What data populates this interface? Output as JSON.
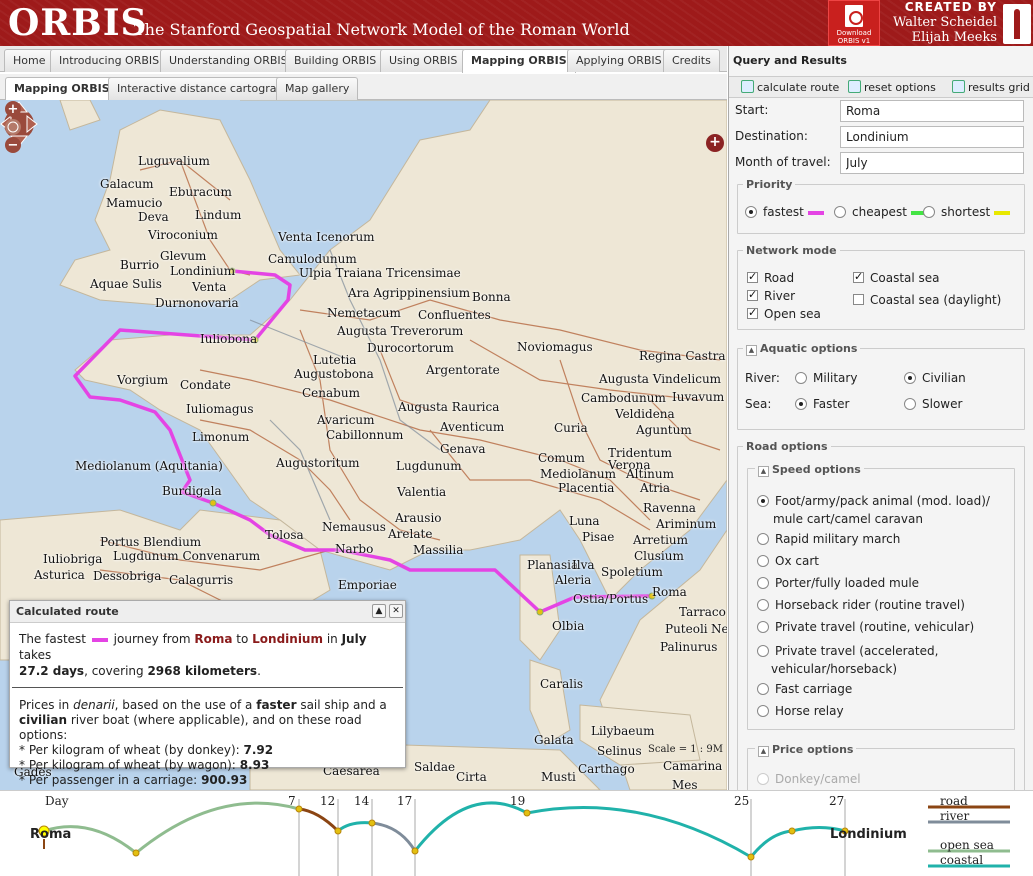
{
  "header": {
    "logo": "ORBIS",
    "subtitle": "The Stanford Geospatial Network Model of the Roman World",
    "download_label_1": "Download",
    "download_label_2": "ORBIS v1",
    "created_by": "CREATED BY",
    "author_1": "Walter Scheidel",
    "author_2": "Elijah Meeks"
  },
  "main_tabs": [
    "Home",
    "Introducing ORBIS",
    "Understanding ORBIS",
    "Building ORBIS",
    "Using ORBIS",
    "Mapping ORBIS",
    "Applying ORBIS",
    "Credits"
  ],
  "sub_tabs": [
    "Mapping ORBIS",
    "Interactive distance cartogram",
    "Map gallery"
  ],
  "map": {
    "scale": "Scale = 1 : 9M",
    "places": [
      {
        "n": "Luguvalium"
      },
      {
        "n": "Galacum"
      },
      {
        "n": "Eburacum"
      },
      {
        "n": "Mamucio"
      },
      {
        "n": "Deva"
      },
      {
        "n": "Lindum"
      },
      {
        "n": "Viroconium"
      },
      {
        "n": "Glevum"
      },
      {
        "n": "Burrio"
      },
      {
        "n": "Londinium"
      },
      {
        "n": "Aquae Sulis"
      },
      {
        "n": "Venta"
      },
      {
        "n": "Durnonovaria"
      },
      {
        "n": "Venta Icenorum"
      },
      {
        "n": "Camulodunum"
      },
      {
        "n": "Ulpia Traiana Tricensimae"
      },
      {
        "n": "Ara Agrippinensium"
      },
      {
        "n": "Bonna"
      },
      {
        "n": "Nemetacum"
      },
      {
        "n": "Confluentes"
      },
      {
        "n": "Augusta Treverorum"
      },
      {
        "n": "Iuliobona"
      },
      {
        "n": "Durocortorum"
      },
      {
        "n": "Noviomagus"
      },
      {
        "n": "Regina Castra"
      },
      {
        "n": "Lutetia"
      },
      {
        "n": "Augustobona"
      },
      {
        "n": "Argentorate"
      },
      {
        "n": "Augusta Vindelicum"
      },
      {
        "n": "Vorgium"
      },
      {
        "n": "Condate"
      },
      {
        "n": "Cenabum"
      },
      {
        "n": "Cambodunum"
      },
      {
        "n": "Iuvavum"
      },
      {
        "n": "Iuliomagus"
      },
      {
        "n": "Augusta Raurica"
      },
      {
        "n": "Veldidena"
      },
      {
        "n": "Avaricum"
      },
      {
        "n": "Aventicum"
      },
      {
        "n": "Curia"
      },
      {
        "n": "Aguntum"
      },
      {
        "n": "Limonum"
      },
      {
        "n": "Cabillonnum"
      },
      {
        "n": "Genava"
      },
      {
        "n": "Tridentum"
      },
      {
        "n": "Mediolanum (Aquitania)"
      },
      {
        "n": "Augustoritum"
      },
      {
        "n": "Lugdunum"
      },
      {
        "n": "Comum"
      },
      {
        "n": "Verona"
      },
      {
        "n": "Mediolanum"
      },
      {
        "n": "Altinum"
      },
      {
        "n": "Valentia"
      },
      {
        "n": "Placentia"
      },
      {
        "n": "Atria"
      },
      {
        "n": "Burdigala"
      },
      {
        "n": "Ravenna"
      },
      {
        "n": "Ariminum"
      },
      {
        "n": "Nemausus"
      },
      {
        "n": "Arausio"
      },
      {
        "n": "Luna"
      },
      {
        "n": "Arelate"
      },
      {
        "n": "Pisae"
      },
      {
        "n": "Tolosa"
      },
      {
        "n": "Portus Blendium"
      },
      {
        "n": "Narbo"
      },
      {
        "n": "Massilia"
      },
      {
        "n": "Arretium"
      },
      {
        "n": "Lugdunum Convenarum"
      },
      {
        "n": "Clusium"
      },
      {
        "n": "Iuliobriga"
      },
      {
        "n": "Planasia"
      },
      {
        "n": "Ilva"
      },
      {
        "n": "Spoletium"
      },
      {
        "n": "Asturica"
      },
      {
        "n": "Dessobriga"
      },
      {
        "n": "Calagurris"
      },
      {
        "n": "Emporiae"
      },
      {
        "n": "Aleria"
      },
      {
        "n": "Roma"
      },
      {
        "n": "Ostia/Portus"
      },
      {
        "n": "Tarraco"
      },
      {
        "n": "Olbia"
      },
      {
        "n": "Puteoli"
      },
      {
        "n": "Ne"
      },
      {
        "n": "Palinurus"
      },
      {
        "n": "Caralis"
      },
      {
        "n": "Lilybaeum"
      },
      {
        "n": "Galata"
      },
      {
        "n": "Selinus"
      },
      {
        "n": "Carthago"
      },
      {
        "n": "Camarina"
      },
      {
        "n": "Caesarea"
      },
      {
        "n": "Saldae"
      },
      {
        "n": "Cirta"
      },
      {
        "n": "Musti"
      },
      {
        "n": "Gades"
      },
      {
        "n": "Mes"
      }
    ]
  },
  "popup": {
    "title": "Calculated route",
    "t1": "The fastest",
    "t2": "journey from",
    "from": "Roma",
    "t3": "to",
    "to": "Londinium",
    "t4": "in",
    "month": "July",
    "t5": "takes",
    "days": "27.2 days",
    "t6": ", covering",
    "km": "2968 kilometers",
    "t7": ".",
    "p1": "Prices in",
    "denarii": "denarii",
    "p2": ", based on the use of a",
    "ship": "faster",
    "p3": "sail ship and a",
    "boat": "civilian",
    "p4": "river boat (where applicable), and on these road options:",
    "prices": [
      {
        "label": "* Per kilogram of wheat (by donkey):",
        "val": "7.92"
      },
      {
        "label": "* Per kilogram of wheat (by wagon):",
        "val": "8.93"
      },
      {
        "label": "* Per passenger in a carriage:",
        "val": "900.93"
      }
    ]
  },
  "panel": {
    "title": "Query and Results",
    "calc": "calculate route",
    "reset": "reset options",
    "grid": "results grid",
    "start_label": "Start:",
    "start": "Roma",
    "dest_label": "Destination:",
    "dest": "Londinium",
    "month_label": "Month of travel:",
    "month": "July",
    "priority": "Priority",
    "fastest": "fastest",
    "cheapest": "cheapest",
    "shortest": "shortest",
    "network": "Network mode",
    "road": "Road",
    "river": "River",
    "open_sea": "Open sea",
    "coastal": "Coastal sea",
    "coastal_day": "Coastal sea (daylight)",
    "aquatic": "Aquatic options",
    "river_l": "River:",
    "military": "Military",
    "civilian": "Civilian",
    "sea_l": "Sea:",
    "faster": "Faster",
    "slower": "Slower",
    "road_opts": "Road options",
    "speed_opts": "Speed options",
    "speed": [
      "Foot/army/pack animal (mod. load)/",
      "mule cart/camel caravan",
      "Rapid military march",
      "Ox cart",
      "Porter/fully loaded mule",
      "Horseback rider (routine travel)",
      "Private travel (routine, vehicular)",
      "Private travel (accelerated,",
      "vehicular/horseback)",
      "Fast carriage",
      "Horse relay"
    ],
    "price_opts": "Price options",
    "donkey": "Donkey/camel",
    "colors": {
      "fastest": "#e444e4",
      "cheapest": "#44e444",
      "shortest": "#e8e800"
    }
  },
  "timeline": {
    "day": "Day",
    "ticks": [
      "7",
      "12",
      "14",
      "17",
      "19",
      "25",
      "27"
    ],
    "start": "Roma",
    "end": "Londinium",
    "legend": [
      "road",
      "river",
      "open sea",
      "coastal"
    ],
    "colors": {
      "road": "#8b4513",
      "river": "#7f8c9a",
      "open_sea": "#8fbc8f",
      "coastal": "#20b2aa"
    }
  }
}
